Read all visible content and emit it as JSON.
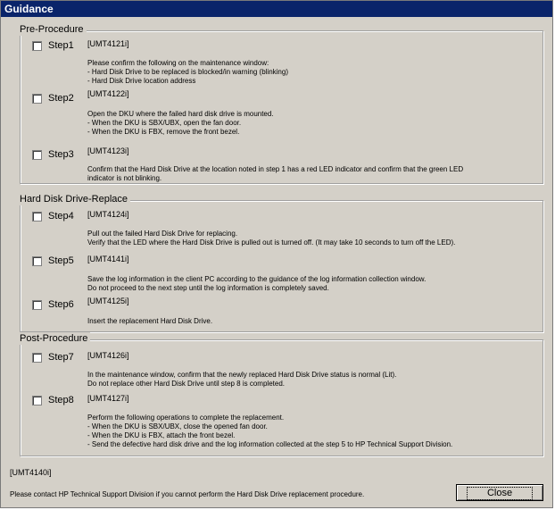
{
  "window": {
    "title": "Guidance"
  },
  "groups": [
    {
      "title": "Pre-Procedure",
      "steps": [
        {
          "label": "Step1",
          "code": "[UMT4121i]",
          "lines": [
            "Please confirm the following on the maintenance window:",
            "- Hard Disk Drive to be replaced is blocked/in warning (blinking)",
            "- Hard Disk Drive location address"
          ]
        },
        {
          "label": "Step2",
          "code": "[UMT4122i]",
          "lines": [
            "Open the DKU where the failed hard disk drive is mounted.",
            "- When the DKU is SBX/UBX, open the fan door.",
            "- When the DKU is FBX, remove the front bezel."
          ]
        },
        {
          "label": "Step3",
          "code": "[UMT4123i]",
          "lines": [
            "Confirm that the Hard Disk Drive at the location noted in step 1 has a red LED indicator and confirm that the green LED",
            "indicator is not blinking."
          ]
        }
      ]
    },
    {
      "title": "Hard Disk Drive-Replace",
      "steps": [
        {
          "label": "Step4",
          "code": "[UMT4124i]",
          "lines": [
            "Pull out the failed Hard Disk Drive for replacing.",
            "Verify that the LED where the Hard Disk Drive is pulled out is turned off. (It may take 10 seconds to turn off the LED)."
          ]
        },
        {
          "label": "Step5",
          "code": "[UMT4141i]",
          "lines": [
            "Save the log information in the client PC according to the guidance of the log information collection window.",
            "Do not proceed to the next step until the log information is completely saved."
          ]
        },
        {
          "label": "Step6",
          "code": "[UMT4125i]",
          "lines": [
            "Insert the replacement Hard Disk Drive."
          ]
        }
      ]
    },
    {
      "title": "Post-Procedure",
      "steps": [
        {
          "label": "Step7",
          "code": "[UMT4126i]",
          "lines": [
            "In the maintenance window, confirm that the newly replaced Hard Disk Drive status is normal (Lit).",
            "Do not replace other Hard Disk Drive until step 8 is completed."
          ]
        },
        {
          "label": "Step8",
          "code": "[UMT4127i]",
          "lines": [
            "Perform the following operations to complete the replacement.",
            "- When the DKU is SBX/UBX, close the opened fan door.",
            "- When the DKU is FBX, attach the front bezel.",
            "- Send the defective hard disk drive and the log information collected at the step 5 to HP Technical Support Division."
          ]
        }
      ]
    }
  ],
  "footer": {
    "code": "[UMT4140i]",
    "message": "Please contact HP Technical Support Division if you cannot perform the Hard Disk Drive replacement procedure.",
    "close_label": "Close"
  }
}
